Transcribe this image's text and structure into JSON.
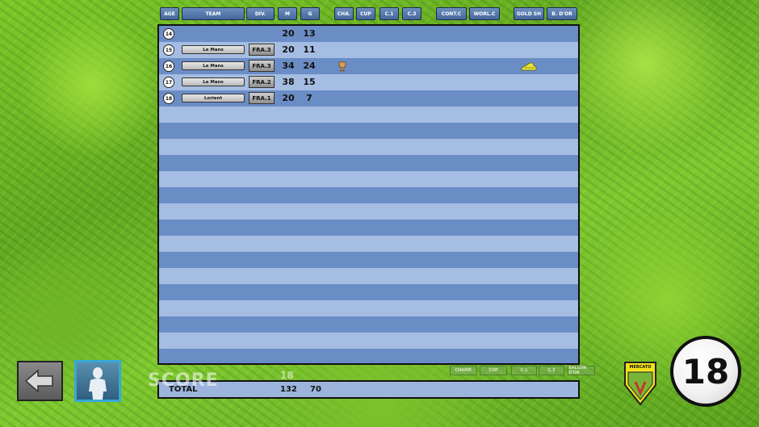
{
  "headers": [
    "AGE",
    "TEAM",
    "DIV.",
    "M",
    "G",
    "CHA.",
    "CUP",
    "C.1",
    "C.3",
    "CONT.C",
    "WORL.C",
    "GOLD SH",
    "B. D'OR"
  ],
  "rows": [
    {
      "age": "14",
      "team": "",
      "div": "",
      "m": "20",
      "g": "13",
      "trophy": false,
      "boot": false
    },
    {
      "age": "15",
      "team": "Le Mans",
      "div": "FRA.3",
      "m": "20",
      "g": "11",
      "trophy": false,
      "boot": false
    },
    {
      "age": "16",
      "team": "Le Mans",
      "div": "FRA.3",
      "m": "34",
      "g": "24",
      "trophy": true,
      "boot": true
    },
    {
      "age": "17",
      "team": "Le Mans",
      "div": "FRA.2",
      "m": "38",
      "g": "15",
      "trophy": false,
      "boot": false
    },
    {
      "age": "18",
      "team": "Lorient",
      "div": "FRA.1",
      "m": "20",
      "g": "7",
      "trophy": false,
      "boot": false
    }
  ],
  "total": {
    "label": "TOTAL",
    "m": "132",
    "g": "70"
  },
  "score_label": "SCORE",
  "score_value": "18",
  "ghost_buttons": [
    "CHAMP.",
    "CUP",
    "C.1",
    "C.3",
    "BALLON D'OR"
  ],
  "mercato_label": "MERCATO",
  "round_number": "18",
  "icons": {
    "back": "back-arrow-icon",
    "avatar": "player-avatar-icon",
    "trophy": "trophy-icon",
    "boot": "golden-boot-icon"
  }
}
